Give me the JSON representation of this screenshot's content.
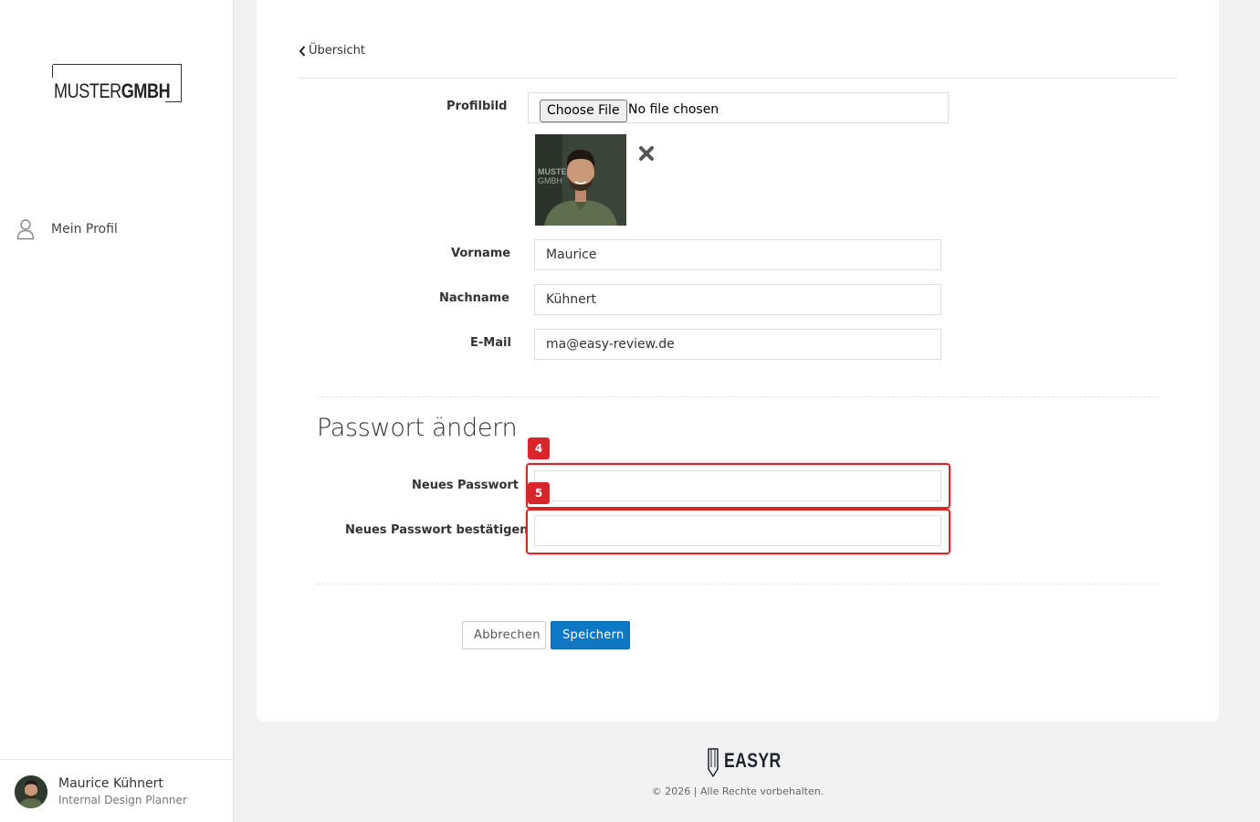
{
  "sidebar": {
    "logo": {
      "part1": "MUSTER",
      "part2": "GMBH"
    },
    "nav": [
      {
        "label": "Mein Profil",
        "icon": "user-icon"
      }
    ],
    "user": {
      "name": "Maurice Kühnert",
      "role": "Internal Design Planner"
    }
  },
  "main": {
    "back_label": "Übersicht",
    "profile_picture": {
      "label": "Profilbild",
      "button_label": "Choose File",
      "status": "No file chosen"
    },
    "fields": {
      "firstname": {
        "label": "Vorname",
        "value": "Maurice"
      },
      "lastname": {
        "label": "Nachname",
        "value": "Kühnert"
      },
      "email": {
        "label": "E-Mail",
        "value": "ma@easy-review.de"
      }
    },
    "password_section": {
      "title": "Passwort ändern",
      "new_password": {
        "label": "Neues Passwort",
        "value": ""
      },
      "confirm_password": {
        "label": "Neues Passwort bestätigen",
        "value": ""
      }
    },
    "annotations": [
      {
        "number": "4"
      },
      {
        "number": "5"
      }
    ],
    "buttons": {
      "cancel": "Abbrechen",
      "save": "Speichern"
    }
  },
  "footer": {
    "brand": "EASYR",
    "copyright": "© 2026 | Alle Rechte vorbehalten."
  },
  "colors": {
    "accent": "#0d78c5",
    "highlight": "#d9262c"
  }
}
